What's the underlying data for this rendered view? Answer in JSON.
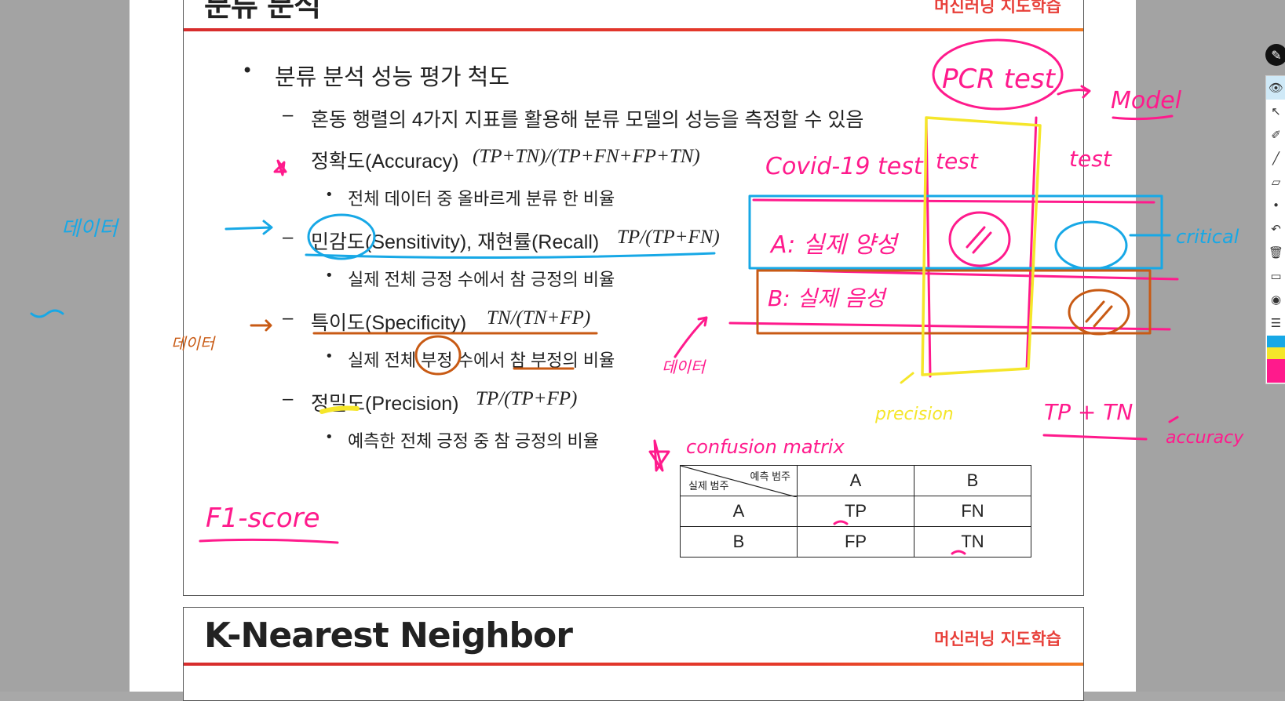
{
  "slide1": {
    "title": "분류 분석",
    "brand": "머신러닝 지도학습",
    "heading": "분류 분석 성능 평가 척도",
    "intro": "혼동 행렬의 4가지 지표를 활용해 분류 모델의 성능을 측정할 수 있음",
    "metrics": [
      {
        "name": "정확도(Accuracy)",
        "formula": "(TP+TN)/(TP+FN+FP+TN)",
        "desc": "전체 데이터 중 올바르게 분류 한 비율"
      },
      {
        "name": "민감도(Sensitivity), 재현률(Recall)",
        "formula": "TP/(TP+FN)",
        "desc": "실제 전체 긍정 수에서 참 긍정의 비율"
      },
      {
        "name": "특이도(Specificity)",
        "formula": "TN/(TN+FP)",
        "desc": "실제 전체 부정 수에서 참 부정의 비율"
      },
      {
        "name": "정밀도(Precision)",
        "formula": "TP/(TP+FP)",
        "desc": "예측한 전체 긍정 중 참 긍정의 비율"
      }
    ],
    "matrix": {
      "corner_top": "예측 범주",
      "corner_bottom": "실제 범주",
      "col_a": "A",
      "col_b": "B",
      "row_a": "A",
      "row_b": "B",
      "tp": "TP",
      "fn": "FN",
      "fp": "FP",
      "tn": "TN"
    }
  },
  "slide2": {
    "title": "K-Nearest Neighbor",
    "brand": "머신러닝 지도학습"
  },
  "annotations": {
    "pcr": "PCR test",
    "model": "Model",
    "covid": "Covid-19 test",
    "test": "test",
    "test_right": "test",
    "row_a": "A: 실제 양성",
    "row_b": "B: 실제 음성",
    "critical": "critical",
    "data": "데이터",
    "f1": "F1-score",
    "confusion": "confusion matrix",
    "precision": "precision",
    "tp_tn": "TP + TN",
    "accuracy": "accuracy"
  },
  "colors": {
    "accent": "#e8403a",
    "pink": "#ff1a8c",
    "cyan": "#17a8e6",
    "orange": "#c85a14",
    "yellow": "#f5e62a"
  }
}
